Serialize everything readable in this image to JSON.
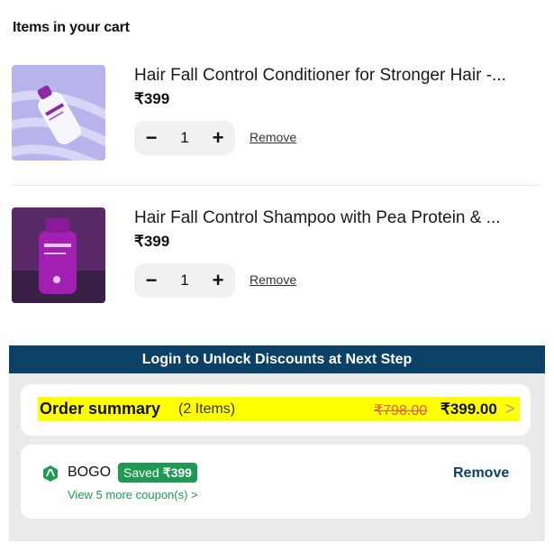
{
  "cart": {
    "heading": "Items in your cart",
    "items": [
      {
        "title": "Hair Fall Control Conditioner for Stronger Hair -...",
        "price": "₹399",
        "qty": "1",
        "minus": "−",
        "plus": "+",
        "remove": "Remove"
      },
      {
        "title": "Hair Fall Control Shampoo with Pea Protein & ...",
        "price": "₹399",
        "qty": "1",
        "minus": "−",
        "plus": "+",
        "remove": "Remove"
      }
    ]
  },
  "banner": {
    "text": "Login to Unlock Discounts at Next Step",
    "color": "#0b4166"
  },
  "summary": {
    "label": "Order summary",
    "count": "(2 Items)",
    "old_price": "₹798.00",
    "new_price": "₹399.00",
    "chevron": ">",
    "highlight_color": "#ffff00"
  },
  "coupon": {
    "icon": "coupon-logo-icon",
    "code": "BOGO",
    "saved_label": "Saved",
    "saved_amount": "₹399",
    "more": "View 5 more coupon(s) >",
    "remove": "Remove",
    "accent": "#1f9a52"
  }
}
